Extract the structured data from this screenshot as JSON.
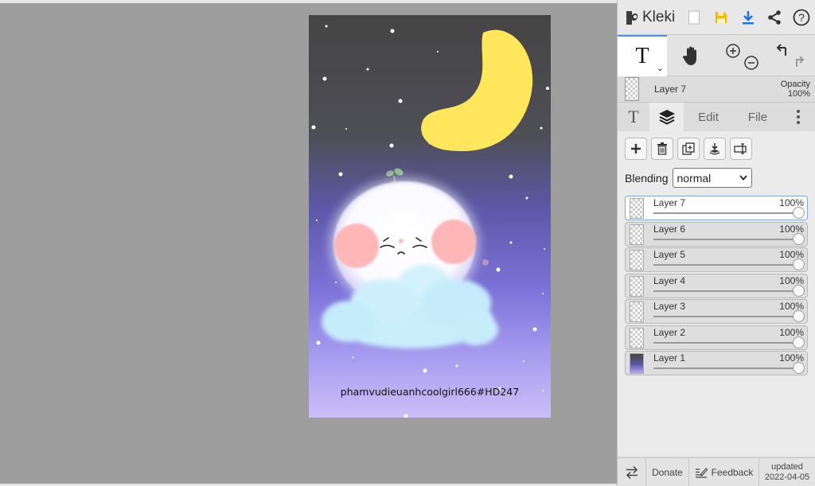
{
  "app": {
    "name": "Kleki"
  },
  "toolbar": {
    "icons": [
      "new-image-icon",
      "save-icon",
      "download-icon",
      "share-icon",
      "help-icon"
    ],
    "undo_icon": "undo-icon",
    "redo_icon": "redo-icon"
  },
  "tools": {
    "active": "text",
    "text_glyph": "T",
    "caret": "⌄"
  },
  "current_layer": {
    "name": "Layer 7",
    "opacity_label": "Opacity",
    "opacity_value": "100%"
  },
  "tabs": [
    {
      "id": "text",
      "label": "T"
    },
    {
      "id": "layers",
      "label": ""
    },
    {
      "id": "edit",
      "label": "Edit"
    },
    {
      "id": "file",
      "label": "File"
    }
  ],
  "blending": {
    "label": "Blending",
    "value": "normal"
  },
  "layers": [
    {
      "name": "Layer 7",
      "opacity": "100%",
      "active": true
    },
    {
      "name": "Layer 6",
      "opacity": "100%",
      "active": false
    },
    {
      "name": "Layer 5",
      "opacity": "100%",
      "active": false
    },
    {
      "name": "Layer 4",
      "opacity": "100%",
      "active": false
    },
    {
      "name": "Layer 3",
      "opacity": "100%",
      "active": false
    },
    {
      "name": "Layer 2",
      "opacity": "100%",
      "active": false
    },
    {
      "name": "Layer 1",
      "opacity": "100%",
      "active": false
    }
  ],
  "canvas": {
    "signature": "phamvudieuanhcoolgirl666#HD247"
  },
  "footer": {
    "donate": "Donate",
    "feedback": "Feedback",
    "updated_label": "updated",
    "updated_date": "2022-04-05"
  },
  "colors": {
    "moon": "#ffe65a",
    "cheeks": "#ffb6b6",
    "cloud": "#c9effc",
    "accent": "#1a73e8",
    "save": "#f5b700"
  }
}
